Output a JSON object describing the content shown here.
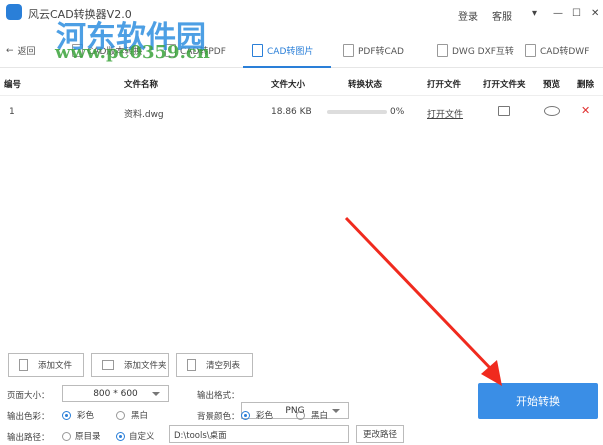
{
  "window": {
    "title": "风云CAD转换器V2.0",
    "login": "登录",
    "service": "客服"
  },
  "watermark": {
    "line1": "河东软件园",
    "line2": "www.pc0359.cn"
  },
  "tabs": [
    {
      "label": "返回"
    },
    {
      "label": "CAD版本转换"
    },
    {
      "label": "CAD转PDF"
    },
    {
      "label": "CAD转图片",
      "active": true
    },
    {
      "label": "PDF转CAD"
    },
    {
      "label": "DWG DXF互转"
    },
    {
      "label": "CAD转DWF"
    }
  ],
  "table": {
    "headers": [
      "编号",
      "文件名称",
      "文件大小",
      "转换状态",
      "打开文件",
      "打开文件夹",
      "预览",
      "删除"
    ],
    "rows": [
      {
        "index": "1",
        "name": "资料.dwg",
        "size": "18.86 KB",
        "progress": 0,
        "progress_text": "0%",
        "open_file": "打开文件"
      }
    ]
  },
  "actions": {
    "add_file": "添加文件",
    "add_folder": "添加文件夹",
    "clear_list": "清空列表"
  },
  "options": {
    "page_size_label": "页面大小：",
    "page_size": "800 * 600",
    "format_label": "输出格式：",
    "format": "PNG",
    "color_label": "输出色彩：",
    "color_opt1": "彩色",
    "color_opt2": "黑白",
    "color_selected": "彩色",
    "bg_label": "背景颜色：",
    "bg_opt1": "彩色",
    "bg_opt2": "黑白",
    "bg_selected": "彩色",
    "path_label": "输出路径：",
    "path_opt1": "原目录",
    "path_opt2": "自定义",
    "path_selected": "自定义",
    "path_value": "D:\\tools\\桌面",
    "change_path": "更改路径"
  },
  "start_button": "开始转换",
  "colors": {
    "accent": "#3a8ee6",
    "delete": "#e03030",
    "arrow": "#f02a1e"
  }
}
